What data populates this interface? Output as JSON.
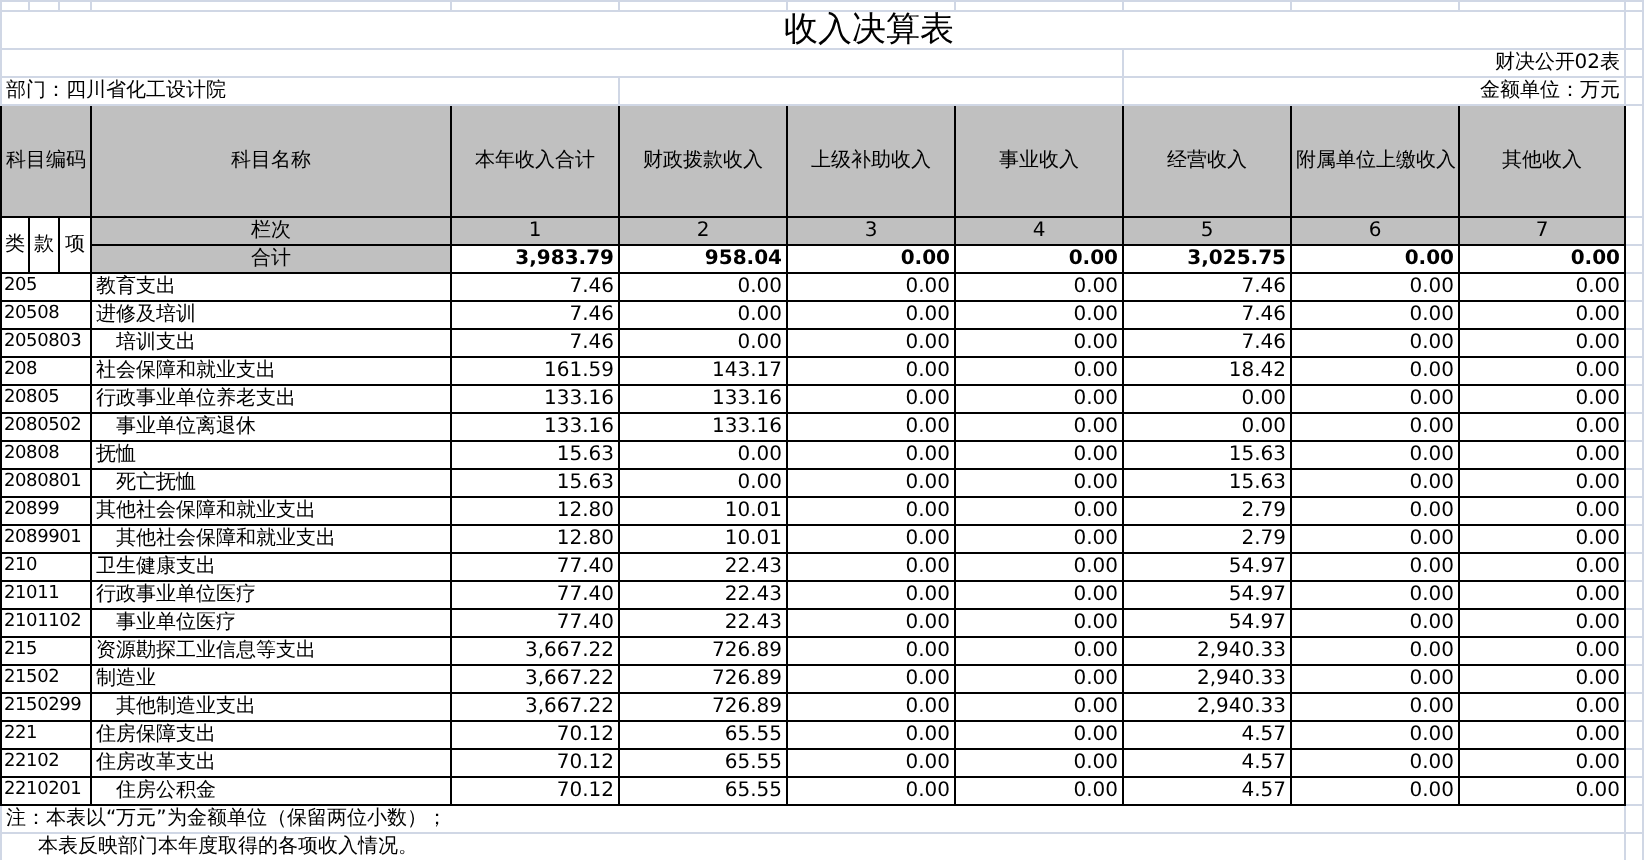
{
  "title": "收入决算表",
  "form_no": "财决公开02表",
  "department": "部门：四川省化工设计院",
  "unit": "金额单位：万元",
  "header": {
    "code": "科目编码",
    "name": "科目名称",
    "columns": [
      "本年收入合计",
      "财政拨款收入",
      "上级补助收入",
      "事业收入",
      "经营收入",
      "附属单位上缴收入",
      "其他收入"
    ],
    "code_parts": [
      "类",
      "款",
      "项"
    ],
    "index_label": "栏次",
    "index_numbers": [
      "1",
      "2",
      "3",
      "4",
      "5",
      "6",
      "7"
    ],
    "total_label": "合计",
    "totals": [
      "3,983.79",
      "958.04",
      "0.00",
      "0.00",
      "3,025.75",
      "0.00",
      "0.00"
    ]
  },
  "rows": [
    {
      "kind": "group",
      "code": "205",
      "name": "教育支出",
      "values": [
        "7.46",
        "0.00",
        "0.00",
        "0.00",
        "7.46",
        "0.00",
        "0.00"
      ]
    },
    {
      "kind": "group",
      "code": "20508",
      "name": "进修及培训",
      "values": [
        "7.46",
        "0.00",
        "0.00",
        "0.00",
        "7.46",
        "0.00",
        "0.00"
      ]
    },
    {
      "kind": "detail",
      "code": "2050803",
      "name": "培训支出",
      "values": [
        "7.46",
        "0.00",
        "0.00",
        "0.00",
        "7.46",
        "0.00",
        "0.00"
      ]
    },
    {
      "kind": "group",
      "code": "208",
      "name": "社会保障和就业支出",
      "values": [
        "161.59",
        "143.17",
        "0.00",
        "0.00",
        "18.42",
        "0.00",
        "0.00"
      ]
    },
    {
      "kind": "group",
      "code": "20805",
      "name": "行政事业单位养老支出",
      "values": [
        "133.16",
        "133.16",
        "0.00",
        "0.00",
        "0.00",
        "0.00",
        "0.00"
      ]
    },
    {
      "kind": "detail",
      "code": "2080502",
      "name": "事业单位离退休",
      "values": [
        "133.16",
        "133.16",
        "0.00",
        "0.00",
        "0.00",
        "0.00",
        "0.00"
      ]
    },
    {
      "kind": "group",
      "code": "20808",
      "name": "抚恤",
      "values": [
        "15.63",
        "0.00",
        "0.00",
        "0.00",
        "15.63",
        "0.00",
        "0.00"
      ]
    },
    {
      "kind": "detail",
      "code": "2080801",
      "name": "死亡抚恤",
      "values": [
        "15.63",
        "0.00",
        "0.00",
        "0.00",
        "15.63",
        "0.00",
        "0.00"
      ]
    },
    {
      "kind": "group",
      "code": "20899",
      "name": "其他社会保障和就业支出",
      "values": [
        "12.80",
        "10.01",
        "0.00",
        "0.00",
        "2.79",
        "0.00",
        "0.00"
      ]
    },
    {
      "kind": "detail",
      "code": "2089901",
      "name": "其他社会保障和就业支出",
      "values": [
        "12.80",
        "10.01",
        "0.00",
        "0.00",
        "2.79",
        "0.00",
        "0.00"
      ]
    },
    {
      "kind": "group",
      "code": "210",
      "name": "卫生健康支出",
      "values": [
        "77.40",
        "22.43",
        "0.00",
        "0.00",
        "54.97",
        "0.00",
        "0.00"
      ]
    },
    {
      "kind": "group",
      "code": "21011",
      "name": "行政事业单位医疗",
      "values": [
        "77.40",
        "22.43",
        "0.00",
        "0.00",
        "54.97",
        "0.00",
        "0.00"
      ]
    },
    {
      "kind": "detail",
      "code": "2101102",
      "name": "事业单位医疗",
      "values": [
        "77.40",
        "22.43",
        "0.00",
        "0.00",
        "54.97",
        "0.00",
        "0.00"
      ]
    },
    {
      "kind": "group",
      "code": "215",
      "name": "资源勘探工业信息等支出",
      "values": [
        "3,667.22",
        "726.89",
        "0.00",
        "0.00",
        "2,940.33",
        "0.00",
        "0.00"
      ]
    },
    {
      "kind": "group",
      "code": "21502",
      "name": "制造业",
      "values": [
        "3,667.22",
        "726.89",
        "0.00",
        "0.00",
        "2,940.33",
        "0.00",
        "0.00"
      ]
    },
    {
      "kind": "detail",
      "code": "2150299",
      "name": "其他制造业支出",
      "values": [
        "3,667.22",
        "726.89",
        "0.00",
        "0.00",
        "2,940.33",
        "0.00",
        "0.00"
      ]
    },
    {
      "kind": "group",
      "code": "221",
      "name": "住房保障支出",
      "values": [
        "70.12",
        "65.55",
        "0.00",
        "0.00",
        "4.57",
        "0.00",
        "0.00"
      ]
    },
    {
      "kind": "group",
      "code": "22102",
      "name": "住房改革支出",
      "values": [
        "70.12",
        "65.55",
        "0.00",
        "0.00",
        "4.57",
        "0.00",
        "0.00"
      ]
    },
    {
      "kind": "detail",
      "code": "2210201",
      "name": "住房公积金",
      "values": [
        "70.12",
        "65.55",
        "0.00",
        "0.00",
        "4.57",
        "0.00",
        "0.00"
      ]
    }
  ],
  "notes": [
    "注：本表以“万元”为金额单位（保留两位小数）；",
    "本表反映部门本年度取得的各项收入情况。"
  ]
}
